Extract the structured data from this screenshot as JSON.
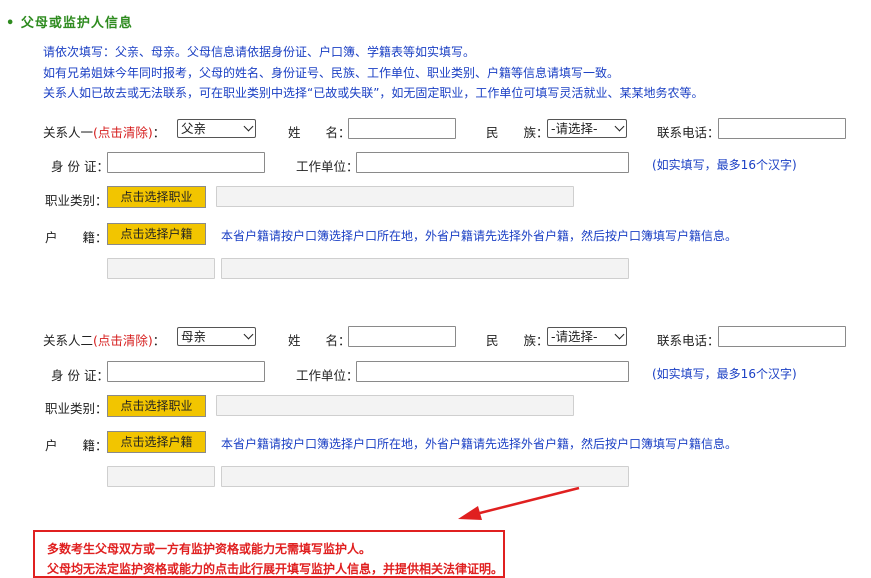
{
  "section_title": "父母或监护人信息",
  "instructions": [
    "请依次填写：父亲、母亲。父母信息请依据身份证、户口簿、学籍表等如实填写。",
    "如有兄弟姐妹今年同时报考，父母的姓名、身份证号、民族、工作单位、职业类别、户籍等信息请填写一致。",
    "关系人如已故去或无法联系，可在职业类别中选择“已故或失联”，如无固定职业，工作单位可填写灵活就业、某某地务农等。"
  ],
  "labels": {
    "name": "姓　　名：",
    "ethnicity": "民　　族：",
    "phone": "联系电话：",
    "id_card": "身 份 证：",
    "work_unit": "工作单位：",
    "occupation": "职业类别：",
    "household": "户　　籍："
  },
  "clear_link": "(点击清除)",
  "choose_occupation": "点击选择职业",
  "choose_household": "点击选择户籍",
  "work_unit_note": "(如实填写，最多16个汉字)",
  "household_note": "本省户籍请按户口簿选择户口所在地，外省户籍请先选择外省户籍，然后按户口簿填写户籍信息。",
  "ethnicity_placeholder": "-请选择-",
  "relations": [
    {
      "label": "关系人一",
      "relation_value": "父亲"
    },
    {
      "label": "关系人二",
      "relation_value": "母亲"
    }
  ],
  "warnings": [
    "多数考生父母双方或一方有监护资格或能力无需填写监护人。",
    "父母均无法定监护资格或能力的点击此行展开填写监护人信息，并提供相关法律证明。"
  ],
  "colors": {
    "title_green": "#2e8b1f",
    "note_blue": "#1a3fc4",
    "warn_red": "#e02020",
    "button_yellow": "#f2c500"
  }
}
